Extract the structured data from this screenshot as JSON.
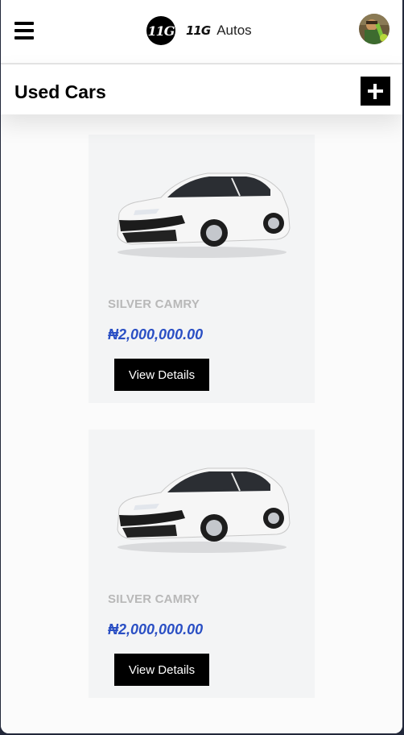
{
  "header": {
    "menu_icon": "hamburger-menu-icon",
    "logo_text": "11G",
    "brand_mark": "11G",
    "brand_name": "Autos",
    "avatar_icon": "user-avatar"
  },
  "page": {
    "title": "Used Cars",
    "add_icon": "plus-icon"
  },
  "listings": [
    {
      "name": "SILVER CAMRY",
      "price": "₦2,000,000.00",
      "button_label": "View Details",
      "image_icon": "car-image"
    },
    {
      "name": "SILVER CAMRY",
      "price": "₦2,000,000.00",
      "button_label": "View Details",
      "image_icon": "car-image"
    }
  ],
  "colors": {
    "price": "#2a4fc4",
    "card_bg": "#f3f4f5",
    "button_bg": "#000000"
  }
}
